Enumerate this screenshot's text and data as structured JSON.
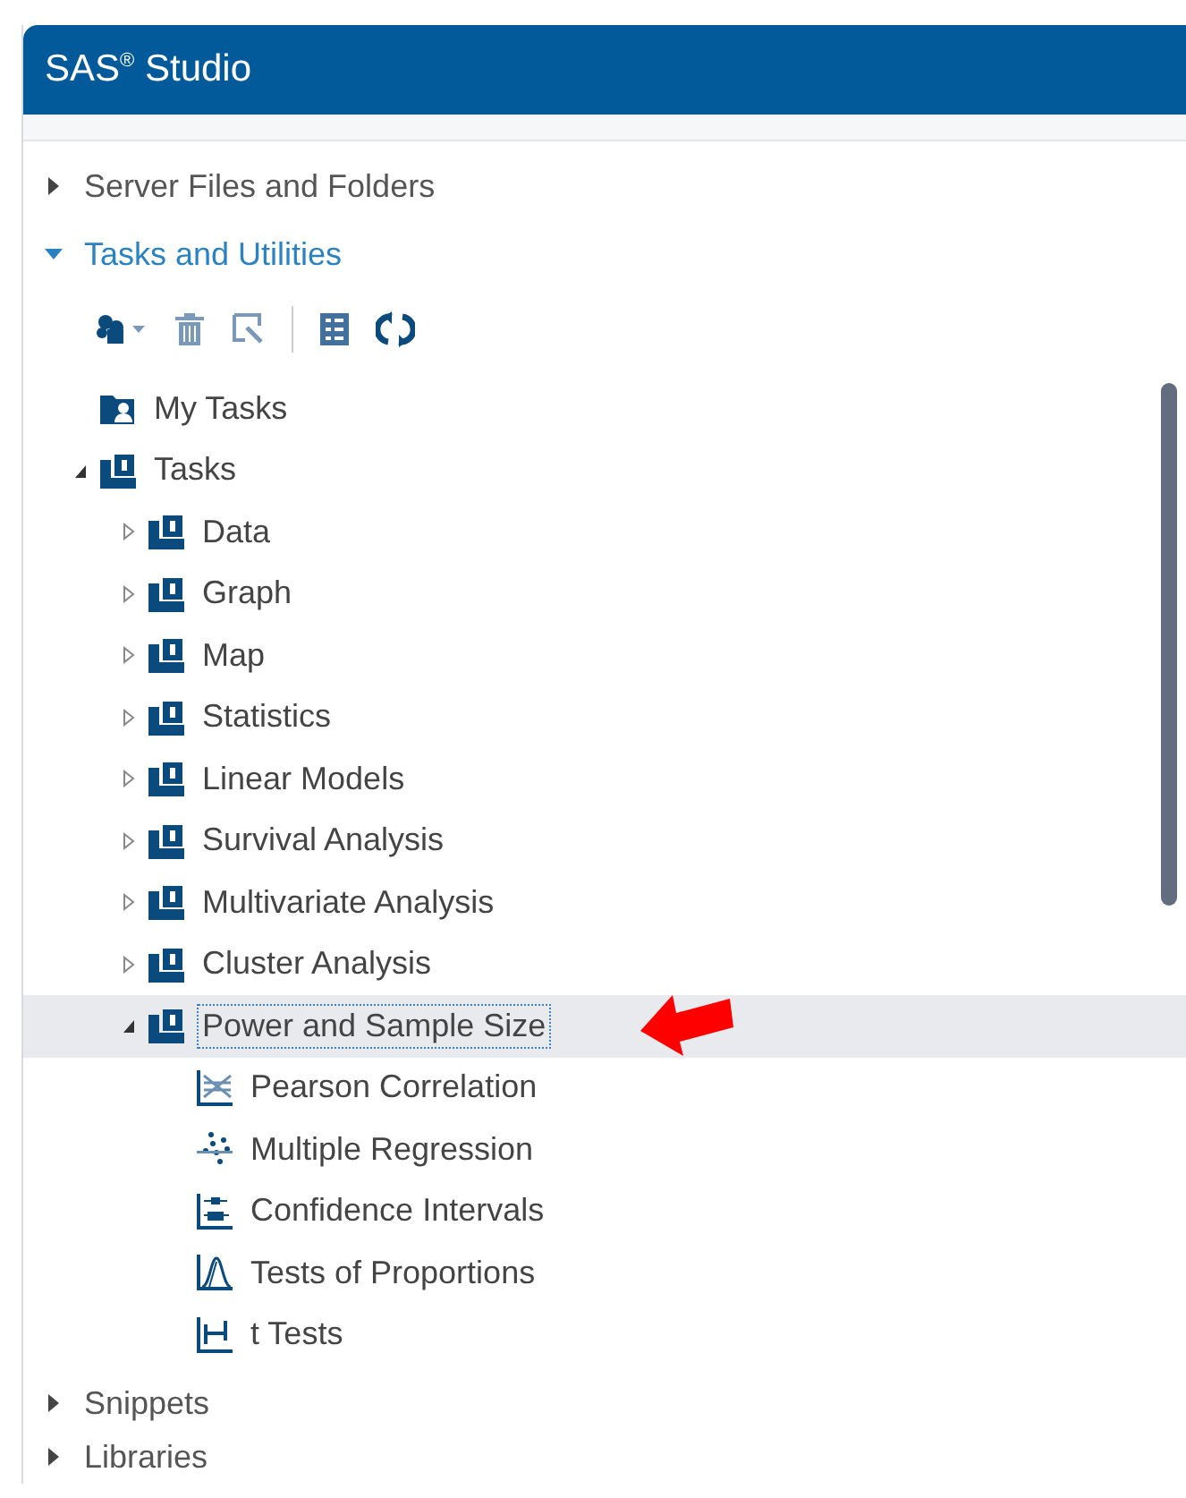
{
  "window": {
    "title": "SAS$^{®}$ Studio"
  },
  "sections": [
    {
      "label": "Server Files and Folders",
      "expanded": false
    },
    {
      "label": "Tasks and Utilities",
      "expanded": true,
      "toolbar": [
        {
          "kind": "new-task"
        },
        {
          "kind": "delete"
        },
        {
          "kind": "edit"
        },
        {
          "kind": "separator"
        },
        {
          "kind": "view"
        },
        {
          "kind": "refresh"
        }
      ],
      "tree": [
        {
          "label": "My Tasks",
          "kind": "user-folder",
          "selected": false
        },
        {
          "label": "Tasks",
          "kind": "folder",
          "expanded": true,
          "selected": false,
          "children": [
            {
              "label": "Data",
              "kind": "folder",
              "expanded": false,
              "selected": false
            },
            {
              "label": "Graph",
              "kind": "folder",
              "expanded": false,
              "selected": false
            },
            {
              "label": "Map",
              "kind": "folder",
              "expanded": false,
              "selected": false
            },
            {
              "label": "Statistics",
              "kind": "folder",
              "expanded": false,
              "selected": false
            },
            {
              "label": "Linear Models",
              "kind": "folder",
              "expanded": false,
              "selected": false
            },
            {
              "label": "Survival Analysis",
              "kind": "folder",
              "expanded": false,
              "selected": false
            },
            {
              "label": "Multivariate Analysis",
              "kind": "folder",
              "expanded": false,
              "selected": false
            },
            {
              "label": "Cluster Analysis",
              "kind": "folder",
              "expanded": false,
              "selected": false
            },
            {
              "label": "Power and Sample Size",
              "kind": "folder",
              "expanded": true,
              "selected": true,
              "children": [
                {
                  "label": "Pearson Correlation",
                  "kind": "correlation",
                  "selected": false
                },
                {
                  "label": "Multiple Regression",
                  "kind": "regression",
                  "selected": false
                },
                {
                  "label": "Confidence Intervals",
                  "kind": "intervals",
                  "selected": false
                },
                {
                  "label": "Tests of Proportions",
                  "kind": "proportions",
                  "selected": false
                },
                {
                  "label": "t Tests",
                  "kind": "ttest",
                  "selected": false
                }
              ]
            }
          ]
        }
      ]
    },
    {
      "label": "Snippets",
      "expanded": false
    },
    {
      "label": "Libraries",
      "expanded": false
    }
  ]
}
